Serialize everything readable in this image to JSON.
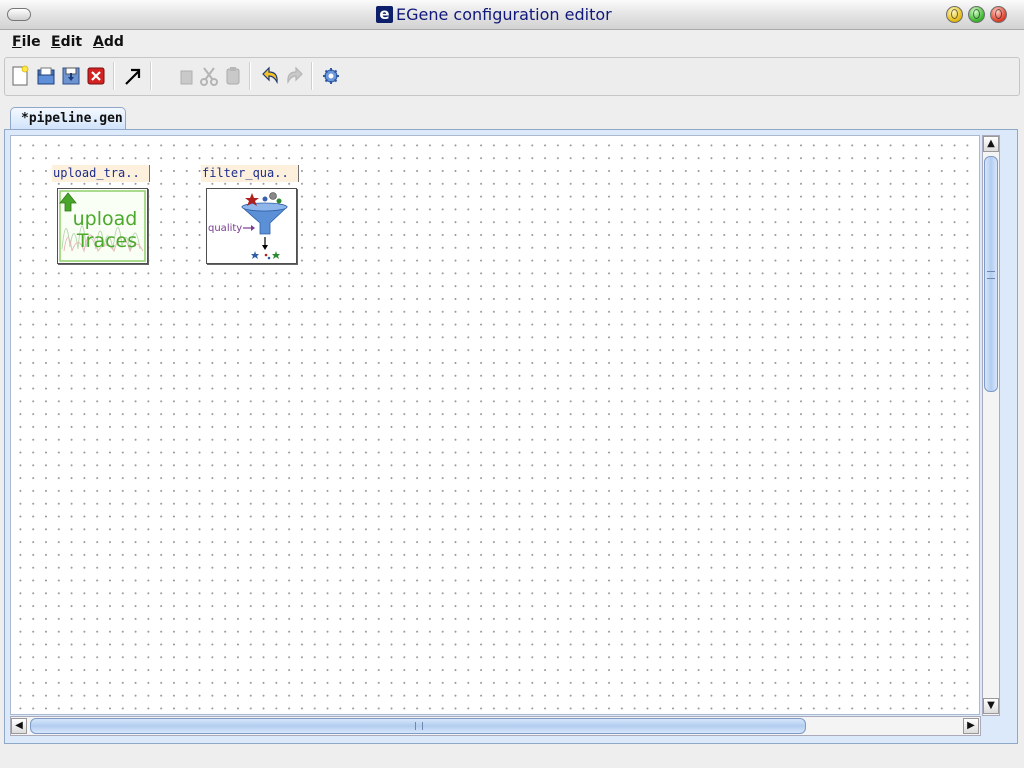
{
  "window": {
    "title": "EGene configuration editor",
    "logo_letter": "e"
  },
  "menu": {
    "items": [
      "File",
      "Edit",
      "Add"
    ]
  },
  "toolbar": {
    "icons": [
      "new-file-icon",
      "open-folder-icon",
      "save-icon",
      "close-file-icon",
      "pointer-arrow-icon",
      "copy-icon",
      "cut-icon",
      "paste-icon",
      "undo-icon",
      "redo-icon",
      "settings-gear-icon"
    ]
  },
  "tabs": [
    {
      "label": "*pipeline.gen",
      "active": true
    }
  ],
  "nodes": [
    {
      "label": "upload_tra..",
      "icon": "upload-traces-icon",
      "icon_text_line1": "upload",
      "icon_text_line2": "Traces"
    },
    {
      "label": "filter_qua..",
      "icon": "filter-quality-icon",
      "icon_text": "quality"
    }
  ],
  "colors": {
    "title_text": "#10197a",
    "node_label_bg": "#fdf0dc",
    "node_label_text": "#1c2f8c",
    "scroll_thumb": "#b3cdf0"
  }
}
